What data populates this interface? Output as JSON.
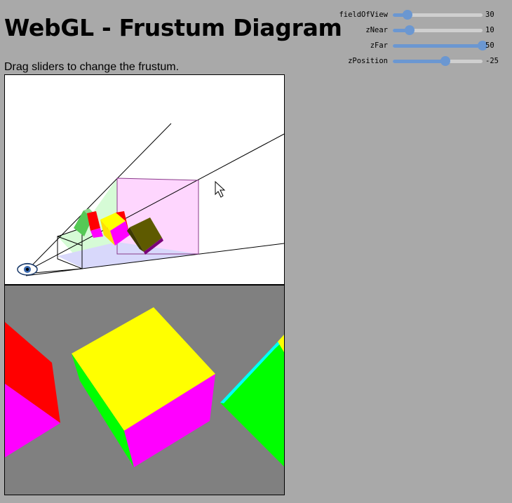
{
  "page": {
    "title": "WebGL - Frustum Diagram",
    "description": "Drag sliders to change the frustum."
  },
  "controls": [
    {
      "id": "fieldOfView",
      "label": "fieldOfView",
      "value": 30,
      "min": 1,
      "max": 179
    },
    {
      "id": "zNear",
      "label": "zNear",
      "value": 10,
      "min": 1,
      "max": 50
    },
    {
      "id": "zFar",
      "label": "zFar",
      "value": 50,
      "min": 1,
      "max": 50
    },
    {
      "id": "zPosition",
      "label": "zPosition",
      "value": -25,
      "min": -60,
      "max": 0
    }
  ],
  "colors": {
    "page_background": "#a9a9a9",
    "slider_accent": "#6b97d1",
    "slider_track": "#cfcfcf",
    "scene_background": "#808080",
    "cube_red": "#ff0000",
    "cube_yellow": "#ffff00",
    "cube_magenta": "#ff00ff",
    "cube_green": "#00ff00",
    "cube_cyan": "#00ffff",
    "frustum_near_tint": "#d6fbd6",
    "frustum_far_tint": "#fed6fe",
    "frustum_floor_tint": "#d8d8fb"
  },
  "icons": {
    "camera": "eye-icon",
    "cursor": "mouse-pointer-icon"
  }
}
